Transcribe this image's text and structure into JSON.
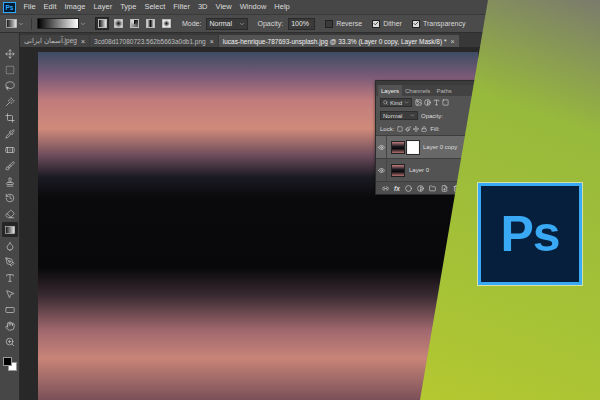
{
  "app": {
    "logo": "Ps"
  },
  "menu": [
    "File",
    "Edit",
    "Image",
    "Layer",
    "Type",
    "Select",
    "Filter",
    "3D",
    "View",
    "Window",
    "Help"
  ],
  "options_bar": {
    "gradient_types": [
      {
        "selected": true
      },
      {
        "selected": false
      },
      {
        "selected": false
      },
      {
        "selected": false
      },
      {
        "selected": false
      }
    ],
    "mode_label": "Mode:",
    "mode": "Normal",
    "opacity_label": "Opacity:",
    "opacity": "100%",
    "checkboxes": [
      {
        "label": "Reverse",
        "checked": false
      },
      {
        "label": "Dither",
        "checked": true
      },
      {
        "label": "Transparency",
        "checked": true
      }
    ]
  },
  "document_tabs": [
    {
      "label": "آسمان ایرانی.jpeg",
      "close": "×",
      "selected": false
    },
    {
      "label": "3cd08d17080723.562b5663a0db1.png",
      "close": "×",
      "selected": false
    },
    {
      "label": "lucas-henrique-787693-unsplash.jpg @ 33.3% (Layer 0 copy, Layer Mask/8) *",
      "close": "×",
      "selected": true
    }
  ],
  "toolbar": {
    "tools": [
      {
        "selected": false
      },
      {
        "selected": false
      },
      {
        "selected": false
      },
      {
        "selected": false
      },
      {
        "selected": false
      },
      {
        "selected": false
      },
      {
        "selected": false
      },
      {
        "selected": false
      },
      {
        "selected": false
      },
      {
        "selected": false
      },
      {
        "selected": false
      },
      {
        "selected": true
      },
      {
        "selected": false
      },
      {
        "selected": false
      },
      {
        "selected": false
      },
      {
        "selected": false
      },
      {
        "selected": false
      },
      {
        "selected": false
      },
      {
        "selected": false
      }
    ]
  },
  "layers_panel": {
    "tabs": [
      {
        "label": "Layers",
        "selected": true
      },
      {
        "label": "Channels",
        "selected": false
      },
      {
        "label": "Paths",
        "selected": false
      }
    ],
    "filter": "Kind",
    "blend_mode": "Normal",
    "opacity_label": "Opacity:",
    "lock_label": "Lock:",
    "fill_label": "Fill:",
    "layers": [
      {
        "name": "Layer 0 copy",
        "visible": true,
        "selected": true,
        "mask": true
      },
      {
        "name": "Layer 0",
        "visible": true,
        "selected": false,
        "mask": false
      }
    ],
    "fx_label": "fx"
  },
  "badge": {
    "logo": "Ps"
  }
}
